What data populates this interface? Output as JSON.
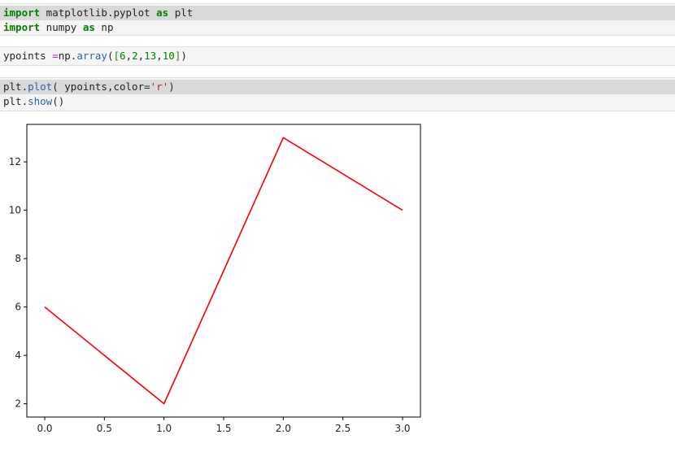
{
  "cells": [
    {
      "lines": [
        [
          {
            "t": "import",
            "c": "kw"
          },
          {
            "t": " matplotlib.pyplot ",
            "c": ""
          },
          {
            "t": "as",
            "c": "kw"
          },
          {
            "t": " plt",
            "c": ""
          }
        ],
        [
          {
            "t": "import",
            "c": "kw"
          },
          {
            "t": " numpy ",
            "c": ""
          },
          {
            "t": "as",
            "c": "kw"
          },
          {
            "t": " np",
            "c": ""
          }
        ]
      ]
    },
    {
      "lines": [
        [
          {
            "t": "ypoints ",
            "c": ""
          },
          {
            "t": "=",
            "c": "op"
          },
          {
            "t": "np.",
            "c": ""
          },
          {
            "t": "array",
            "c": "fn"
          },
          {
            "t": "(",
            "c": ""
          },
          {
            "t": "[",
            "c": "brk"
          },
          {
            "t": "6",
            "c": "num"
          },
          {
            "t": ",",
            "c": ""
          },
          {
            "t": "2",
            "c": "num"
          },
          {
            "t": ",",
            "c": ""
          },
          {
            "t": "13",
            "c": "num"
          },
          {
            "t": ",",
            "c": ""
          },
          {
            "t": "10",
            "c": "num"
          },
          {
            "t": "]",
            "c": "brk"
          },
          {
            "t": ")",
            "c": ""
          }
        ]
      ]
    },
    {
      "lines": [
        [
          {
            "t": "plt.",
            "c": ""
          },
          {
            "t": "plot",
            "c": "fn"
          },
          {
            "t": "( ypoints,color=",
            "c": ""
          },
          {
            "t": "'r'",
            "c": "str"
          },
          {
            "t": ")",
            "c": ""
          }
        ],
        [
          {
            "t": "plt.",
            "c": ""
          },
          {
            "t": "show",
            "c": "fn"
          },
          {
            "t": "()",
            "c": ""
          }
        ]
      ]
    }
  ],
  "chart_data": {
    "type": "line",
    "x": [
      0,
      1,
      2,
      3
    ],
    "series": [
      {
        "values": [
          6,
          2,
          13,
          10
        ],
        "color": "#ff0000"
      }
    ],
    "xlim": [
      -0.15,
      3.15
    ],
    "ylim": [
      1.45,
      13.55
    ],
    "xticks": [
      "0.0",
      "0.5",
      "1.0",
      "1.5",
      "2.0",
      "2.5",
      "3.0"
    ],
    "yticks": [
      "2",
      "4",
      "6",
      "8",
      "10",
      "12"
    ],
    "grid": false,
    "title": "",
    "xlabel": "",
    "ylabel": ""
  }
}
